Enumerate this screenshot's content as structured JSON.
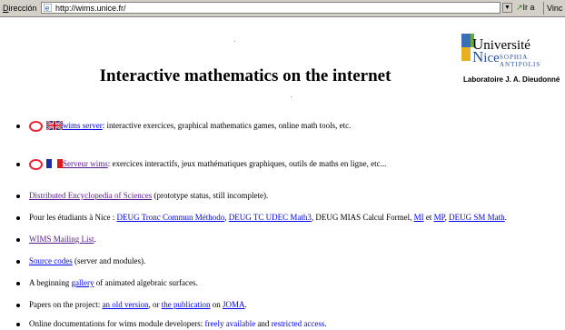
{
  "addressbar": {
    "label_prefix": "D",
    "label_rest": "irección",
    "url": "http://wims.unice.fr/",
    "go_label": "Ir a",
    "links_label": "Vinc"
  },
  "title": "Interactive mathematics on the internet",
  "logo": {
    "line1": "niversité",
    "line2": "ice",
    "line3": "SOPHIA ANTIPOLIS",
    "lab": "Laboratoire J. A. Dieudonné"
  },
  "items": {
    "wims_server": {
      "link": "wims server",
      "text": ": interactive exercices, graphical mathematics games, online math tools, etc."
    },
    "serveur_wims": {
      "link": "Serveur wims",
      "text": ": exercices interactifs, jeux mathématiques graphiques, outils de maths en ligne, etc..."
    },
    "encyclopedia": {
      "link": "Distributed Encyclopedia of Sciences",
      "text": " (prototype status, still incomplete)."
    },
    "nice": {
      "pre": "Pour les étudiants à Nice : ",
      "l1": "DEUG Tronc Commun Méthodo",
      "s1": ", ",
      "l2": "DEUG TC UDEC Math3",
      "s2": ", DEUG MIAS Calcul Formel, ",
      "l3": "MI",
      "s3": " et ",
      "l4": "MP",
      "s4": ", ",
      "l5": "DEUG SM Math",
      "s5": "."
    },
    "mailing": {
      "link": "WIMS Mailing List",
      "text": "."
    },
    "source": {
      "link": "Source codes",
      "text": " (server and modules)."
    },
    "gallery": {
      "pre": "A beginning ",
      "link": "gallery",
      "post": " of animated algebraic surfaces."
    },
    "papers": {
      "pre": "Papers on the project: ",
      "l1": "an old version",
      "mid": ", or ",
      "l2": "the publication",
      "mid2": " on ",
      "l3": "JOMA",
      "post": "."
    },
    "docs": {
      "pre": "Online documentations for wims module developers: ",
      "l1": "freely available",
      "mid": " and ",
      "l2": "restricted access",
      "post": "."
    }
  }
}
